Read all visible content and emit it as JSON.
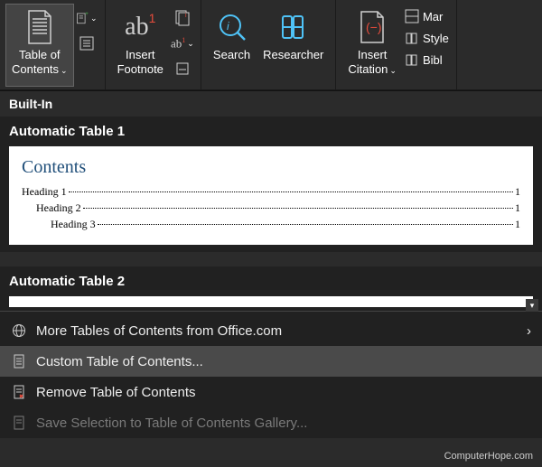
{
  "ribbon": {
    "toc_label": "Table of\nContents",
    "insert_footnote_label": "Insert\nFootnote",
    "search_label": "Search",
    "researcher_label": "Researcher",
    "insert_citation_label": "Insert\nCitation",
    "partial": {
      "manage": "Mar",
      "style": "Style",
      "bibliography": "Bibl"
    }
  },
  "gallery": {
    "builtin": "Built-In",
    "auto1": "Automatic Table 1",
    "auto2": "Automatic Table 2",
    "preview": {
      "title": "Contents",
      "h1": "Heading 1",
      "h2": "Heading 2",
      "h3": "Heading 3",
      "page": "1"
    }
  },
  "menu": {
    "more": "More Tables of Contents from Office.com",
    "custom": "Custom Table of Contents...",
    "remove": "Remove Table of Contents",
    "save": "Save Selection to Table of Contents Gallery..."
  },
  "watermark": "ComputerHope.com"
}
